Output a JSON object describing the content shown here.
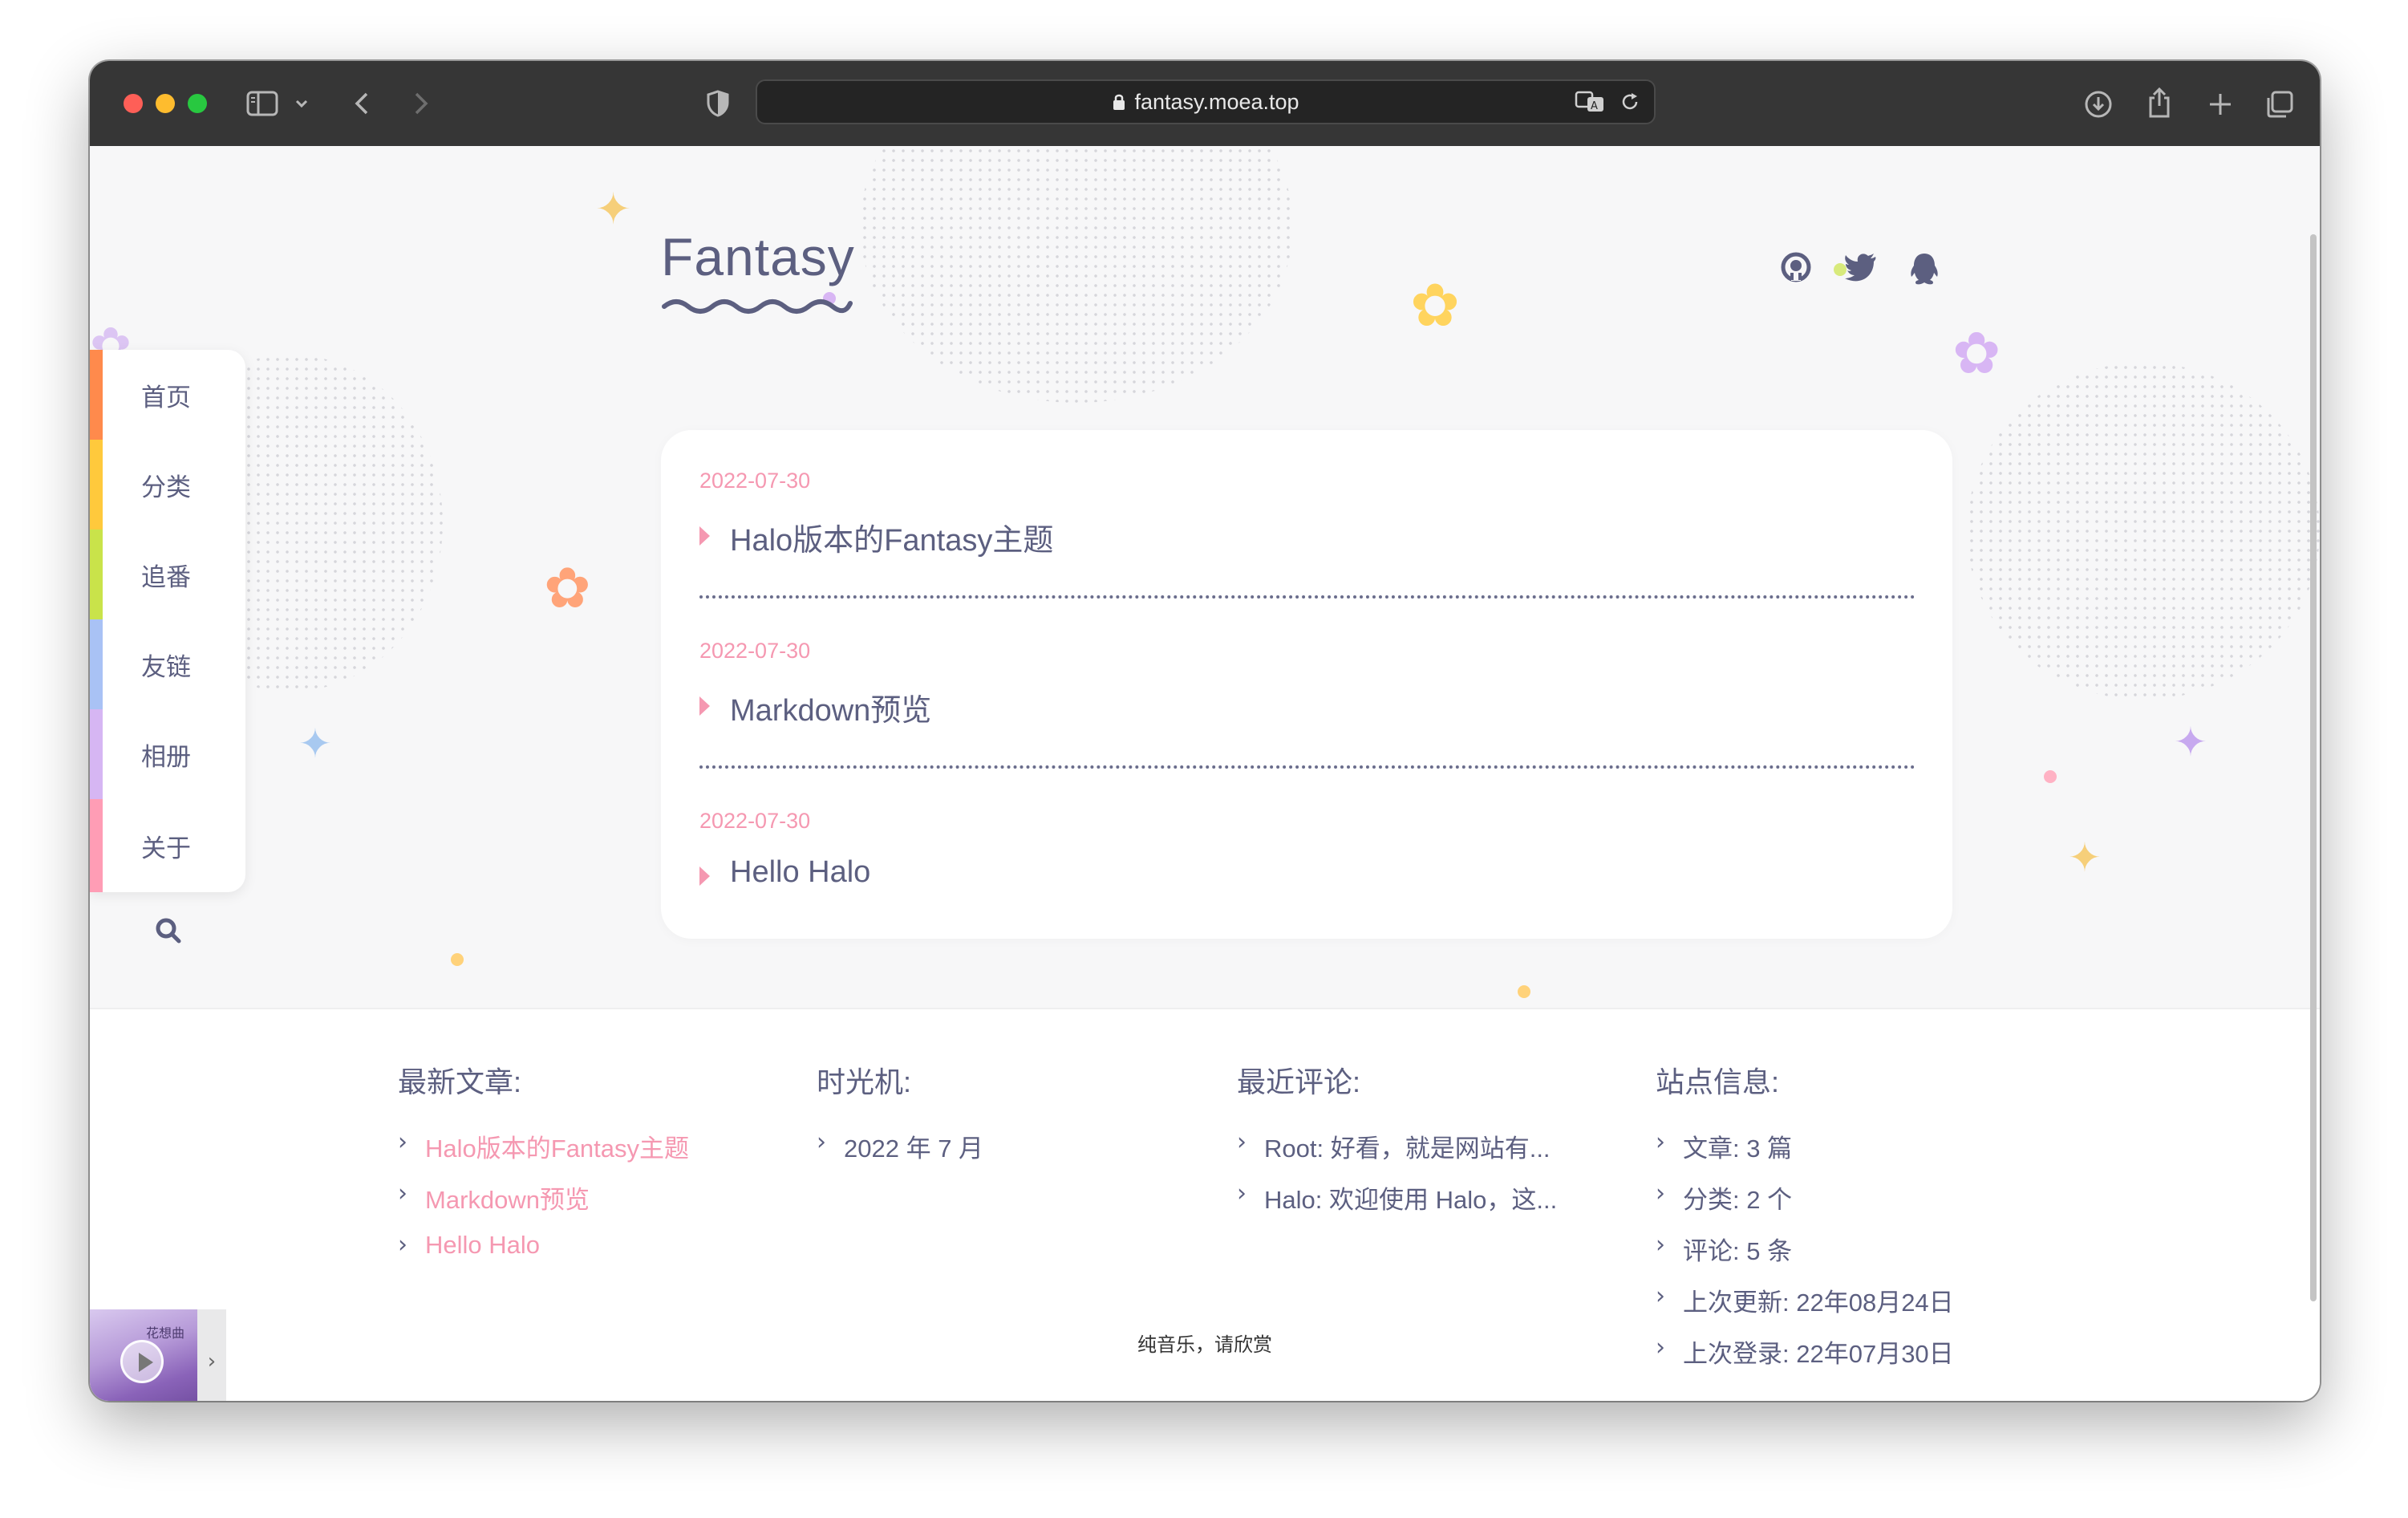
{
  "browser": {
    "url": "fantasy.moea.top"
  },
  "site": {
    "title": "Fantasy"
  },
  "nav": {
    "items": [
      {
        "label": "首页",
        "color": "#ff8a4c"
      },
      {
        "label": "分类",
        "color": "#ffc93c"
      },
      {
        "label": "追番",
        "color": "#c9e34a"
      },
      {
        "label": "友链",
        "color": "#a9c2f5"
      },
      {
        "label": "相册",
        "color": "#d6b6f3"
      },
      {
        "label": "关于",
        "color": "#ff9db5"
      }
    ]
  },
  "social": [
    "github-icon",
    "twitter-icon",
    "qq-icon"
  ],
  "posts": [
    {
      "date": "2022-07-30",
      "title": "Halo版本的Fantasy主题"
    },
    {
      "date": "2022-07-30",
      "title": "Markdown预览"
    },
    {
      "date": "2022-07-30",
      "title": "Hello Halo"
    }
  ],
  "footer": {
    "latest": {
      "heading": "最新文章:",
      "items": [
        "Halo版本的Fantasy主题",
        "Markdown预览",
        "Hello Halo"
      ]
    },
    "archive": {
      "heading": "时光机:",
      "items": [
        "2022 年 7 月"
      ]
    },
    "comments": {
      "heading": "最近评论:",
      "items": [
        "Root: 好看，就是网站有...",
        "Halo: 欢迎使用 Halo，这..."
      ]
    },
    "info": {
      "heading": "站点信息:",
      "items": [
        "文章: 3 篇",
        "分类: 2 个",
        "评论: 5 条",
        "上次更新: 22年08月24日",
        "上次登录: 22年07月30日"
      ]
    }
  },
  "player": {
    "cover_text": "花想曲",
    "caption": "纯音乐，请欣赏"
  },
  "colors": {
    "accent_pink": "#f598b1",
    "text": "#5c5f80"
  }
}
